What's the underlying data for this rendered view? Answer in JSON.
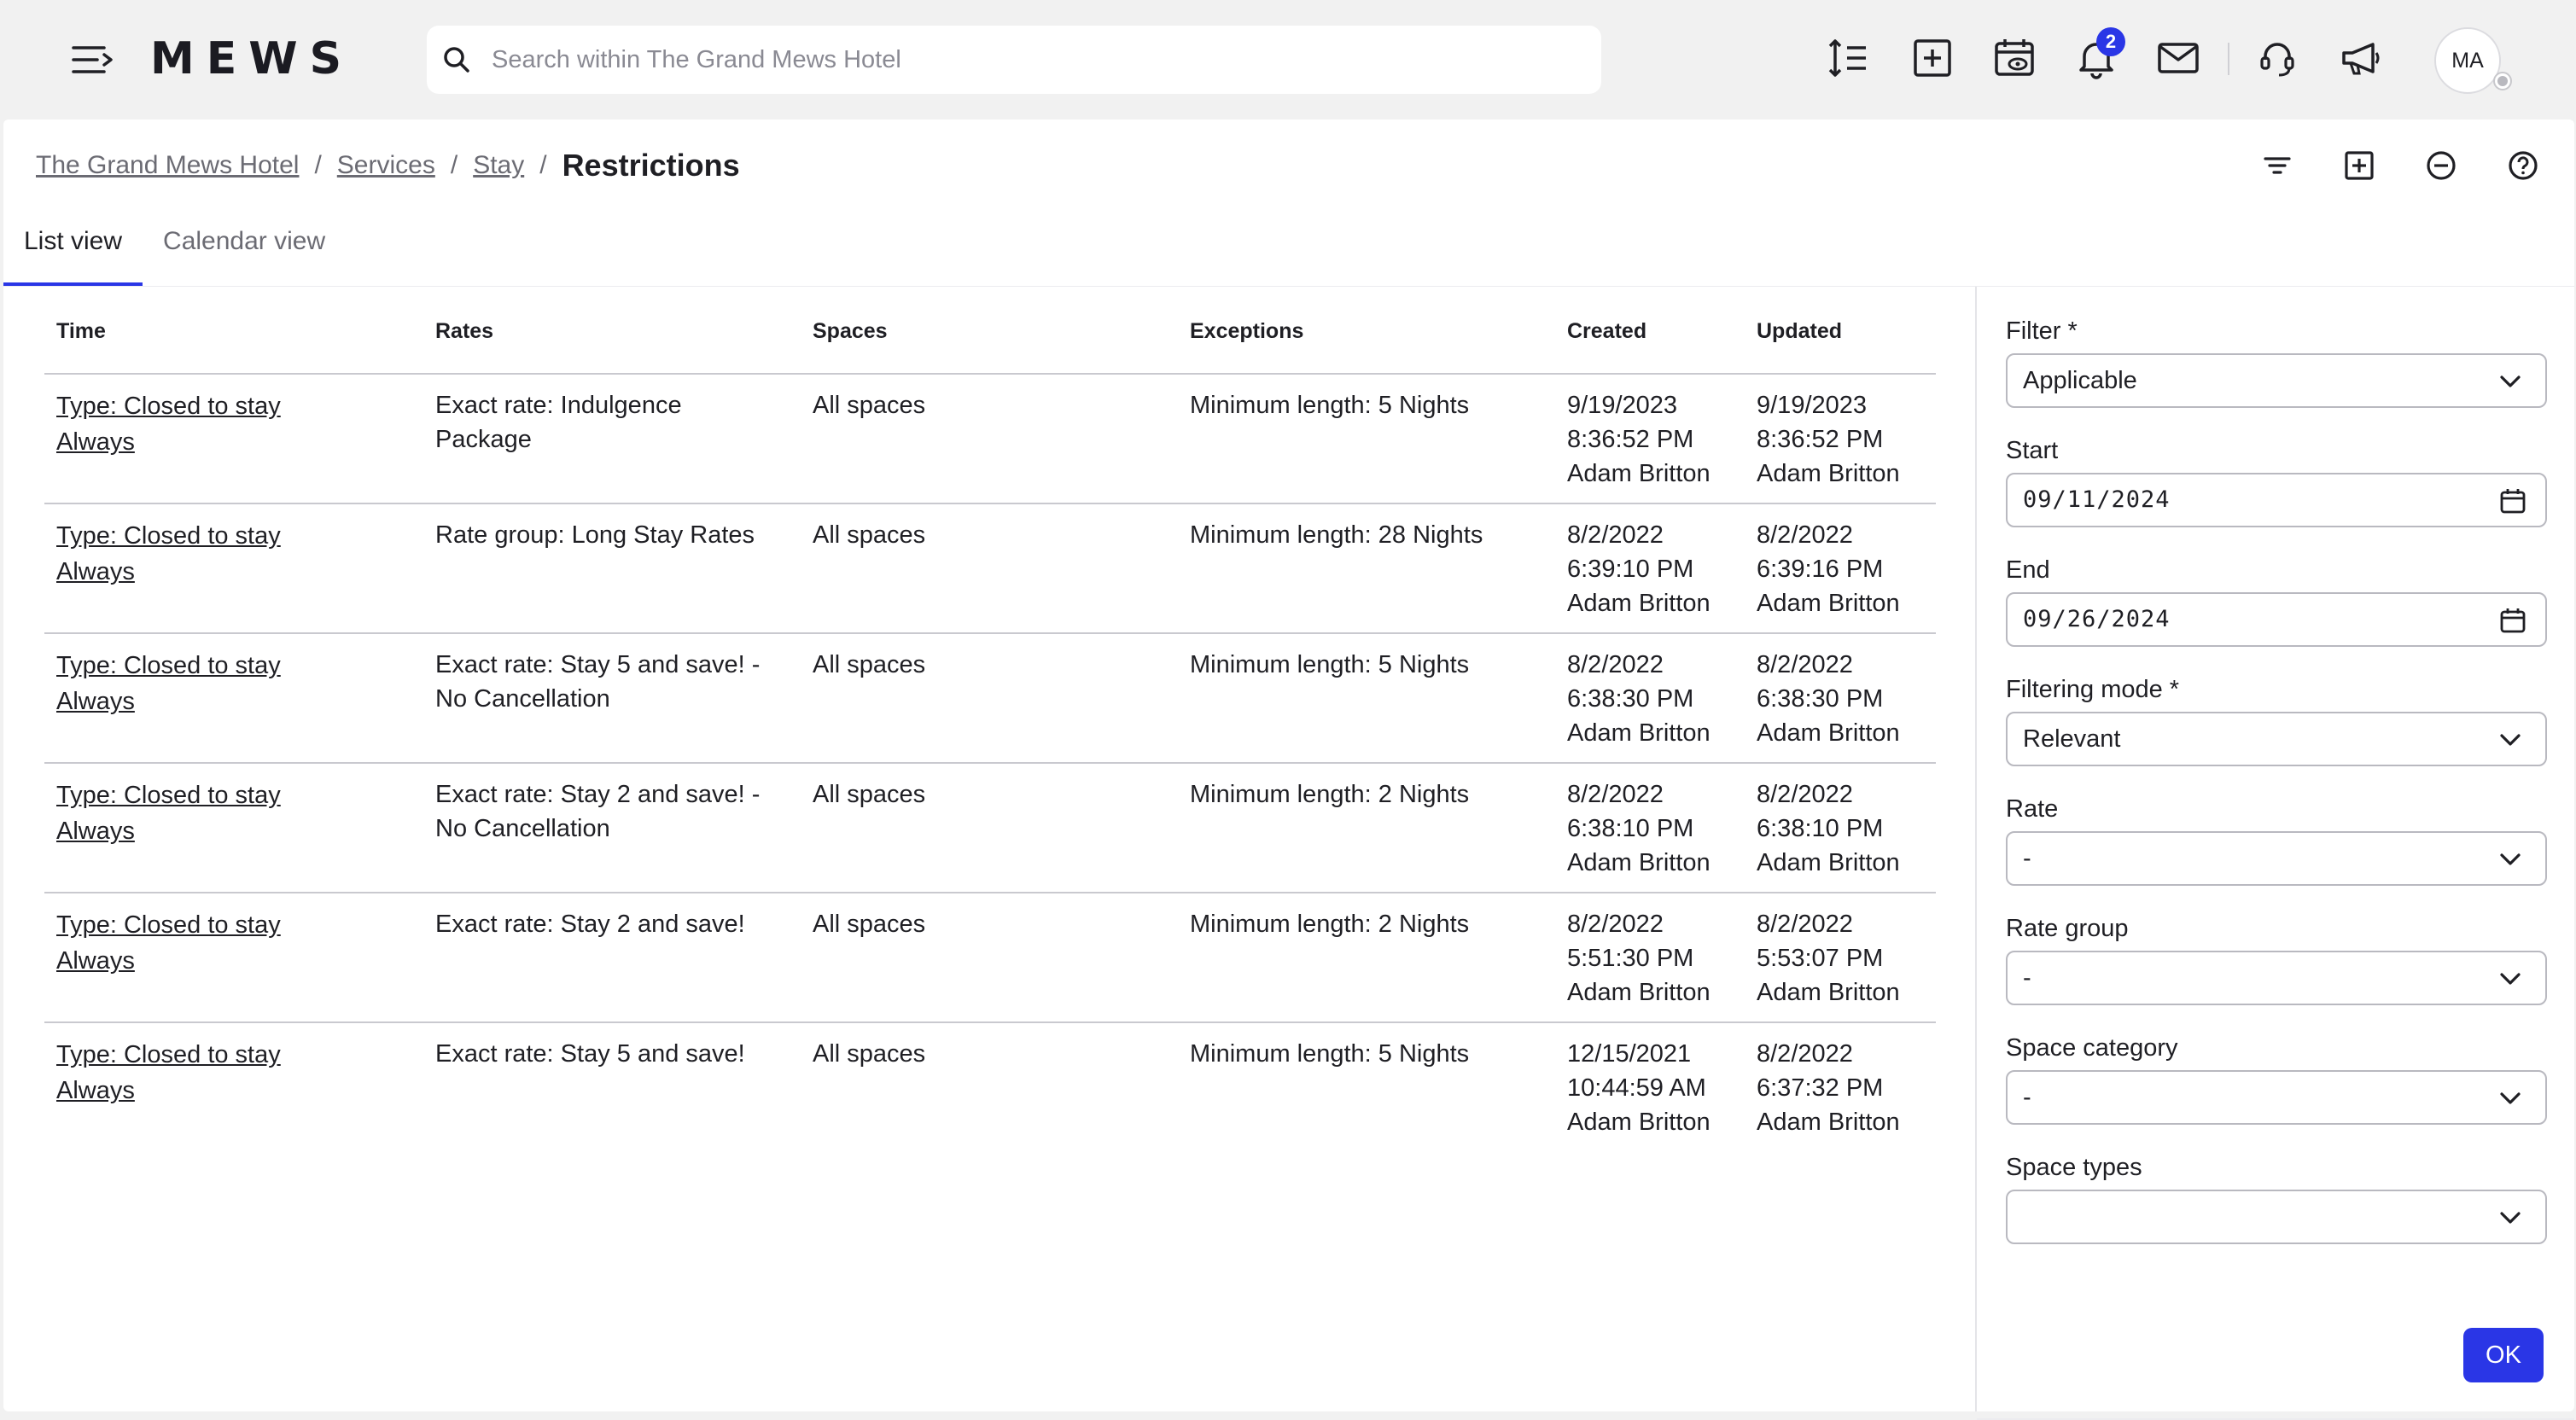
{
  "app": {
    "logo": "MEWS"
  },
  "search": {
    "placeholder": "Search within The Grand Mews Hotel"
  },
  "topbar": {
    "notifications_count": "2",
    "avatar_initials": "MA"
  },
  "breadcrumb": {
    "items": [
      "The Grand Mews Hotel",
      "Services",
      "Stay"
    ],
    "separator": "/",
    "current": "Restrictions"
  },
  "tabs": [
    {
      "label": "List view",
      "active": true
    },
    {
      "label": "Calendar view",
      "active": false
    }
  ],
  "table": {
    "columns": [
      "Time",
      "Rates",
      "Spaces",
      "Exceptions",
      "Created",
      "Updated"
    ],
    "rows": [
      {
        "time": [
          "Type: Closed to stay",
          "Always"
        ],
        "rates": [
          "Exact rate: Indulgence",
          "Package"
        ],
        "spaces": "All spaces",
        "exceptions": "Minimum length: 5 Nights",
        "created": [
          "9/19/2023",
          "8:36:52 PM",
          "Adam Britton"
        ],
        "updated": [
          "9/19/2023",
          "8:36:52 PM",
          "Adam Britton"
        ]
      },
      {
        "time": [
          "Type: Closed to stay",
          "Always"
        ],
        "rates": [
          "Rate group: Long Stay Rates",
          ""
        ],
        "spaces": "All spaces",
        "exceptions": "Minimum length: 28 Nights",
        "created": [
          "8/2/2022",
          "6:39:10 PM",
          "Adam Britton"
        ],
        "updated": [
          "8/2/2022",
          "6:39:16 PM",
          "Adam Britton"
        ]
      },
      {
        "time": [
          "Type: Closed to stay",
          "Always"
        ],
        "rates": [
          "Exact rate: Stay 5 and save! -",
          "No Cancellation"
        ],
        "spaces": "All spaces",
        "exceptions": "Minimum length: 5 Nights",
        "created": [
          "8/2/2022",
          "6:38:30 PM",
          "Adam Britton"
        ],
        "updated": [
          "8/2/2022",
          "6:38:30 PM",
          "Adam Britton"
        ]
      },
      {
        "time": [
          "Type: Closed to stay",
          "Always"
        ],
        "rates": [
          "Exact rate: Stay 2 and save! -",
          "No Cancellation"
        ],
        "spaces": "All spaces",
        "exceptions": "Minimum length: 2 Nights",
        "created": [
          "8/2/2022",
          "6:38:10 PM",
          "Adam Britton"
        ],
        "updated": [
          "8/2/2022",
          "6:38:10 PM",
          "Adam Britton"
        ]
      },
      {
        "time": [
          "Type: Closed to stay",
          "Always"
        ],
        "rates": [
          "Exact rate: Stay 2 and save!",
          ""
        ],
        "spaces": "All spaces",
        "exceptions": "Minimum length: 2 Nights",
        "created": [
          "8/2/2022",
          "5:51:30 PM",
          "Adam Britton"
        ],
        "updated": [
          "8/2/2022",
          "5:53:07 PM",
          "Adam Britton"
        ]
      },
      {
        "time": [
          "Type: Closed to stay",
          "Always"
        ],
        "rates": [
          "Exact rate: Stay 5 and save!",
          ""
        ],
        "spaces": "All spaces",
        "exceptions": "Minimum length: 5 Nights",
        "created": [
          "12/15/2021",
          "10:44:59 AM",
          "Adam Britton"
        ],
        "updated": [
          "8/2/2022",
          "6:37:32 PM",
          "Adam Britton"
        ]
      }
    ]
  },
  "filters": {
    "filter": {
      "label": "Filter *",
      "value": "Applicable"
    },
    "start": {
      "label": "Start",
      "value": "09/11/2024"
    },
    "end": {
      "label": "End",
      "value": "09/26/2024"
    },
    "filtering_mode": {
      "label": "Filtering mode *",
      "value": "Relevant"
    },
    "rate": {
      "label": "Rate",
      "value": "-"
    },
    "rate_group": {
      "label": "Rate group",
      "value": "-"
    },
    "space_category": {
      "label": "Space category",
      "value": "-"
    },
    "space_types": {
      "label": "Space types",
      "value": ""
    },
    "ok_label": "OK"
  },
  "colors": {
    "accent": "#2a36e6",
    "topbar_bg": "#f1f1f1",
    "text": "#1f1f24"
  }
}
